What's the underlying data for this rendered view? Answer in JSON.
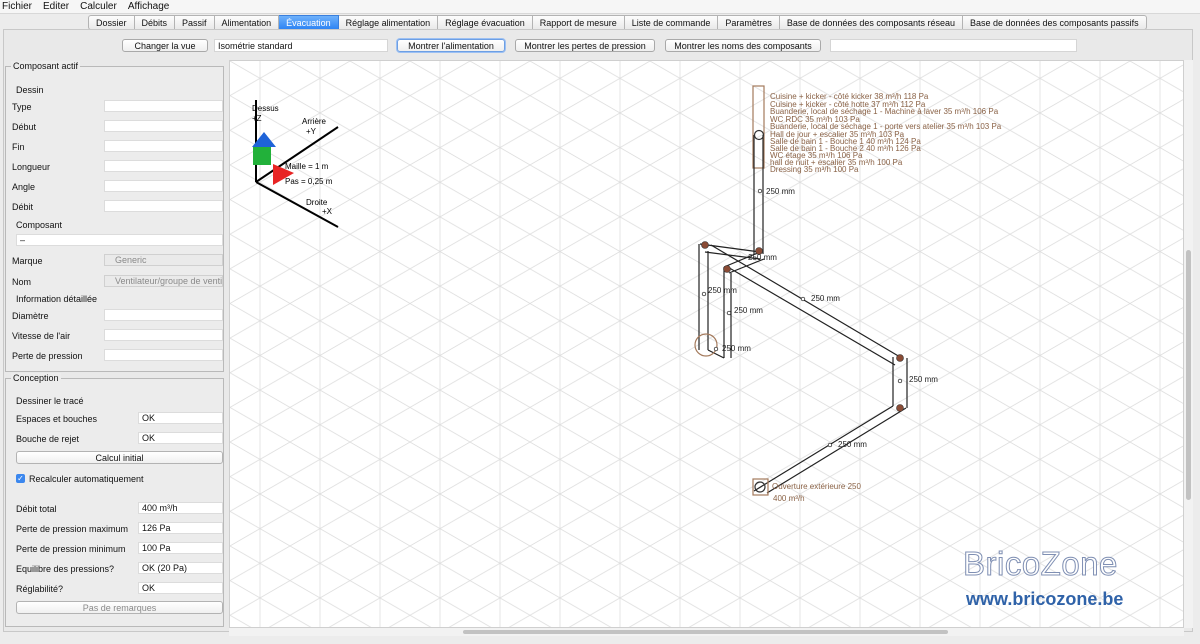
{
  "menu": [
    "Fichier",
    "Editer",
    "Calculer",
    "Affichage"
  ],
  "tabs": [
    "Dossier",
    "Débits",
    "Passif",
    "Alimentation",
    "Évacuation",
    "Réglage alimentation",
    "Réglage évacuation",
    "Rapport de mesure",
    "Liste de commande",
    "Paramètres",
    "Base de données des composants réseau",
    "Base de données des composants passifs"
  ],
  "active_tab_index": 4,
  "toolbar": {
    "change_view": "Changer la vue",
    "view_mode": "Isométrie standard",
    "show_supply": "Montrer l'alimentation",
    "show_pressure_losses": "Montrer les pertes de pression",
    "show_component_names": "Montrer les noms des composants",
    "extra_field": ""
  },
  "active_component": {
    "title": "Composant actif",
    "drawing_header": "Dessin",
    "fields": [
      {
        "label": "Type",
        "value": ""
      },
      {
        "label": "Début",
        "value": ""
      },
      {
        "label": "Fin",
        "value": ""
      },
      {
        "label": "Longueur",
        "value": ""
      },
      {
        "label": "Angle",
        "value": ""
      },
      {
        "label": "Débit",
        "value": ""
      }
    ],
    "component_header": "Composant",
    "component_value": "–",
    "brand_label": "Marque",
    "brand_value": "Generic",
    "name_label": "Nom",
    "name_value": "Ventilateur/groupe de ventil",
    "detail_header": "Information détaillée",
    "detail_fields": [
      {
        "label": "Diamètre",
        "value": ""
      },
      {
        "label": "Vitesse de l'air",
        "value": ""
      },
      {
        "label": "Perte de pression",
        "value": ""
      }
    ]
  },
  "design": {
    "title": "Conception",
    "draw_header": "Dessiner le tracé",
    "spaces_label": "Espaces et bouches",
    "spaces_value": "OK",
    "exhaust_label": "Bouche de rejet",
    "exhaust_value": "OK",
    "initial_calc": "Calcul initial",
    "auto_recalc": "Recalculer automatiquement",
    "auto_recalc_checked": true,
    "results": [
      {
        "label": "Débit total",
        "value": "400 m³/h"
      },
      {
        "label": "Perte de pression maximum",
        "value": "126 Pa"
      },
      {
        "label": "Perte de pression minimum",
        "value": "100 Pa"
      },
      {
        "label": "Equilibre des pressions?",
        "value": "OK (20 Pa)"
      },
      {
        "label": "Réglabilité?",
        "value": "OK"
      }
    ],
    "remarks": "Pas de remarques"
  },
  "diagram": {
    "axes": {
      "top": "Dessus",
      "top_axis": "+Z",
      "back": "Arrière",
      "back_axis": "+Y",
      "right": "Droite",
      "right_axis": "+X",
      "grid": "Maille = 1 m",
      "step": "Pas = 0,25 m"
    },
    "vent_labels": [
      "Cuisine + kicker - côté kicker  38 m³/h 118 Pa",
      "Cuisine + kicker - côté hotte  37 m³/h 112 Pa",
      "Buanderie, local de séchage 1 - Machine à laver  35 m³/h 106 Pa",
      "WC RDC  35 m³/h 103 Pa",
      "Buanderie, local de séchage 1 - porte vers atelier  35 m³/h 103 Pa",
      "Hall de jour + escalier  35 m³/h 103 Pa",
      "Salle de bain 1 - Bouche 1  40 m³/h 124 Pa",
      "Salle de bain 1 - Bouche 2  40 m³/h 126 Pa",
      "WC étage  35 m³/h 106 Pa",
      "hall de nuit + escalier  35 m³/h 100 Pa",
      "Dressing  35 m³/h 100 Pa"
    ],
    "duct_labels": [
      "250 mm",
      "250 mm",
      "250 mm",
      "250 mm",
      "250 mm",
      "250 mm",
      "250 mm",
      "250 mm"
    ],
    "exterior_label": "Ouverture extérieure 250",
    "exterior_flow": "400 m³/h"
  },
  "watermark": {
    "brand": "BricoZone",
    "url": "www.bricozone.be"
  }
}
